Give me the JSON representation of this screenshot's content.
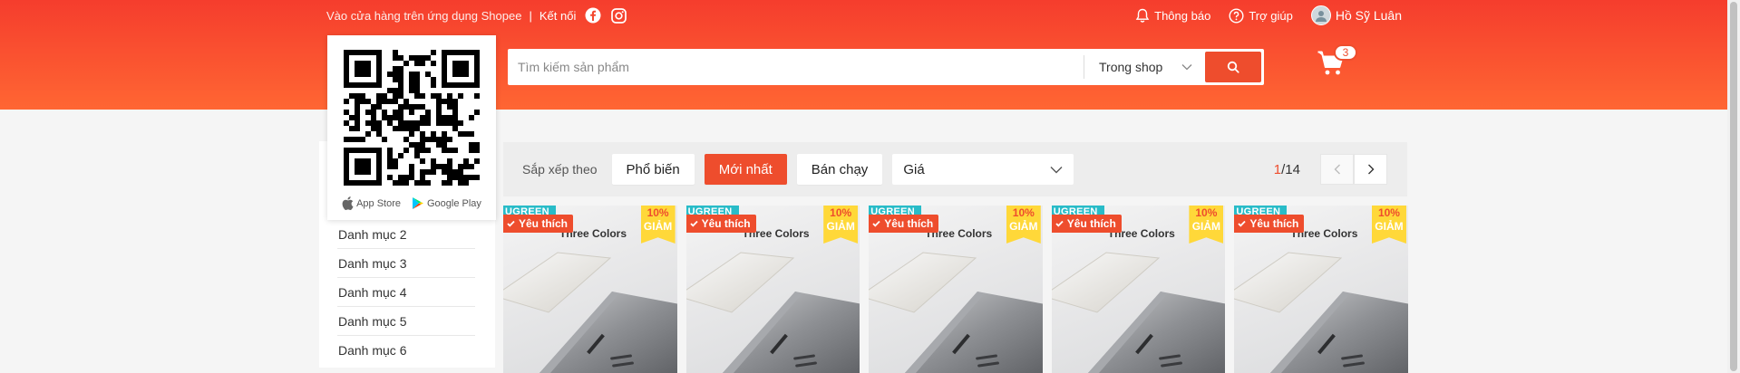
{
  "topbar": {
    "app_text": "Vào cửa hàng trên ứng dụng Shopee",
    "separator": "|",
    "connect_label": "Kết nối",
    "notifications_label": "Thông báo",
    "help_label": "Trợ giúp",
    "username": "Hồ Sỹ Luân"
  },
  "search": {
    "placeholder": "Tìm kiếm sản phẩm",
    "scope_label": "Trong shop"
  },
  "cart": {
    "count": "3"
  },
  "qr_popup": {
    "app_store_label": "App Store",
    "google_play_label": "Google Play"
  },
  "sidebar": {
    "categories": [
      "Danh mục 2",
      "Danh mục 3",
      "Danh mục 4",
      "Danh mục 5",
      "Danh mục 6"
    ]
  },
  "sortbar": {
    "label": "Sắp xếp theo",
    "options": [
      "Phổ biến",
      "Mới nhất",
      "Bán chạy"
    ],
    "active_option": "Mới nhất",
    "price_label": "Giá"
  },
  "pager": {
    "current": "1",
    "total": "/14"
  },
  "products": [
    {
      "brand": "UGREEN",
      "badge": "Yêu thích",
      "caption": "Three Colors",
      "discount": "10%",
      "discount_label": "GIẢM"
    },
    {
      "brand": "UGREEN",
      "badge": "Yêu thích",
      "caption": "Three Colors",
      "discount": "10%",
      "discount_label": "GIẢM"
    },
    {
      "brand": "UGREEN",
      "badge": "Yêu thích",
      "caption": "Three Colors",
      "discount": "10%",
      "discount_label": "GIẢM"
    },
    {
      "brand": "UGREEN",
      "badge": "Yêu thích",
      "caption": "Three Colors",
      "discount": "10%",
      "discount_label": "GIẢM"
    },
    {
      "brand": "UGREEN",
      "badge": "Yêu thích",
      "caption": "Three Colors",
      "discount": "10%",
      "discount_label": "GIẢM"
    }
  ],
  "colors": {
    "brand": "#ee4d2d",
    "discount_tag": "#ffd839",
    "brand_tag": "#29bcc8"
  }
}
